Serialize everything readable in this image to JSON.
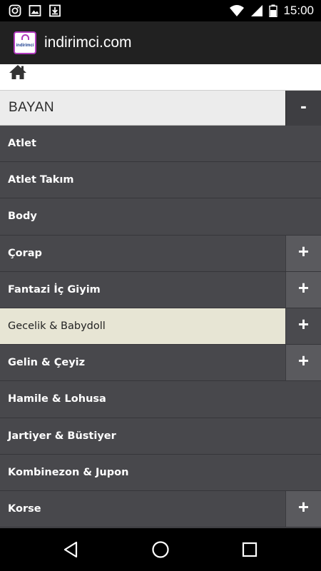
{
  "status_bar": {
    "left_icons": [
      "instagram-icon",
      "image-icon",
      "download-icon"
    ],
    "right_icons": [
      "wifi-icon",
      "signal-icon",
      "battery-icon"
    ],
    "time": "15:00"
  },
  "app_bar": {
    "logo_text": "indirimci",
    "title": "indirimci.com"
  },
  "category": {
    "label": "BAYAN",
    "toggle_label": "-"
  },
  "menu": {
    "items": [
      {
        "label": "Atlet",
        "expandable": false,
        "selected": false
      },
      {
        "label": "Atlet Takım",
        "expandable": false,
        "selected": false
      },
      {
        "label": "Body",
        "expandable": false,
        "selected": false
      },
      {
        "label": "Çorap",
        "expandable": true,
        "selected": false
      },
      {
        "label": "Fantazi İç Giyim",
        "expandable": true,
        "selected": false
      },
      {
        "label": "Gecelik & Babydoll",
        "expandable": true,
        "selected": true
      },
      {
        "label": "Gelin & Çeyiz",
        "expandable": true,
        "selected": false
      },
      {
        "label": "Hamile & Lohusa",
        "expandable": false,
        "selected": false
      },
      {
        "label": "Jartiyer & Büstiyer",
        "expandable": false,
        "selected": false
      },
      {
        "label": "Kombinezon & Jupon",
        "expandable": false,
        "selected": false
      },
      {
        "label": "Korse",
        "expandable": true,
        "selected": false
      }
    ],
    "expand_label": "+"
  },
  "nav_bar": {
    "buttons": [
      "back-icon",
      "home-circle-icon",
      "recents-icon"
    ]
  },
  "colors": {
    "list_bg": "#48484c",
    "selected_bg": "#e7e5d4",
    "app_bar_bg": "#212121"
  }
}
